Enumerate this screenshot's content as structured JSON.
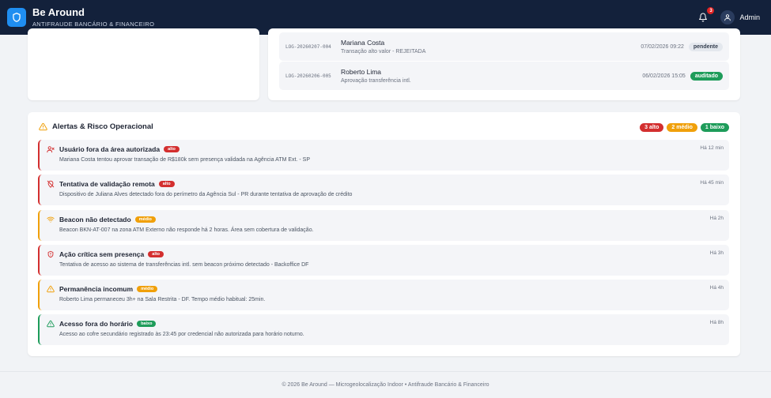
{
  "header": {
    "title": "Be Around",
    "subtitle": "ANTIFRAUDE BANCÁRIO & FINANCEIRO",
    "notification_count": "3",
    "user_name": "Admin"
  },
  "logs": [
    {
      "id": "LOG-20260207-004",
      "name": "Mariana Costa",
      "desc": "Transação alto valor - REJEITADA",
      "time": "07/02/2026 09:22",
      "status": "pendente"
    },
    {
      "id": "LOG-20260206-005",
      "name": "Roberto Lima",
      "desc": "Aprovação transferência intl.",
      "time": "06/02/2026 15:05",
      "status": "auditado"
    }
  ],
  "alerts_section": {
    "title": "Alertas & Risco Operacional",
    "counts": {
      "alto": "3 alto",
      "medio": "2 médio",
      "baixo": "1 baixo"
    },
    "items": [
      {
        "title": "Usuário fora da área autorizada",
        "severity": "alto",
        "desc": "Mariana Costa tentou aprovar transação de R$180k sem presença validada na Agência ATM Ext. - SP",
        "time": "Há 12 min",
        "icon": "user-x-icon"
      },
      {
        "title": "Tentativa de validação remota",
        "severity": "alto",
        "desc": "Dispositivo de Juliana Alves detectado fora do perímetro da Agência Sul - PR durante tentativa de aprovação de crédito",
        "time": "Há 45 min",
        "icon": "map-pin-off-icon"
      },
      {
        "title": "Beacon não detectado",
        "severity": "médio",
        "desc": "Beacon BKN-AT-007 na zona ATM Externo não responde há 2 horas. Área sem cobertura de validação.",
        "time": "Há 2h",
        "icon": "wifi-icon"
      },
      {
        "title": "Ação crítica sem presença",
        "severity": "alto",
        "desc": "Tentativa de acesso ao sistema de transferências intl. sem beacon próximo detectado - Backoffice DF",
        "time": "Há 3h",
        "icon": "shield-alert-icon"
      },
      {
        "title": "Permanência incomum",
        "severity": "médio",
        "desc": "Roberto Lima permaneceu 3h+ na Sala Restrita - DF. Tempo médio habitual: 25min.",
        "time": "Há 4h",
        "icon": "warning-icon"
      },
      {
        "title": "Acesso fora do horário",
        "severity": "baixo",
        "desc": "Acesso ao cofre secundário registrado às 23:45 por credencial não autorizada para horário noturno.",
        "time": "Há 8h",
        "icon": "warning-icon"
      }
    ]
  },
  "footer": {
    "text": "© 2026 Be Around — Microgeolocalização Indoor • Antifraude Bancário & Financeiro"
  },
  "colors": {
    "alto": "#d32f2f",
    "medio": "#f0a00a",
    "baixo": "#1e9c5a",
    "header": "#13213b",
    "brand": "#1f8ef1"
  }
}
